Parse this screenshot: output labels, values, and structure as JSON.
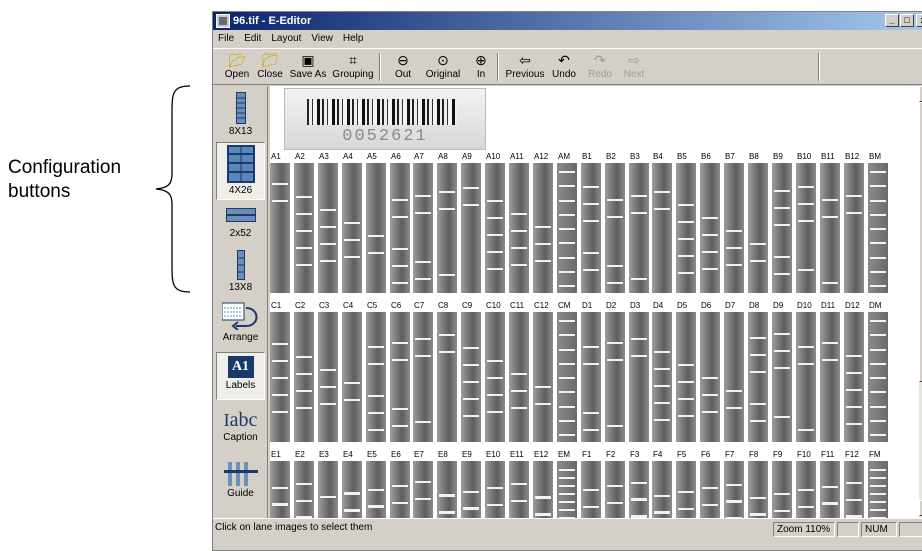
{
  "annotation": {
    "callout_line1": "Configuration",
    "callout_line2": "buttons"
  },
  "window": {
    "title": "96.tif - E-Editor",
    "min_glyph": "_",
    "max_glyph": "□",
    "close_glyph": "x"
  },
  "menu": [
    "File",
    "Edit",
    "Layout",
    "View",
    "Help"
  ],
  "toolbar": {
    "open": "Open",
    "close": "Close",
    "save_as": "Save As",
    "grouping": "Grouping",
    "out": "Out",
    "original": "Original",
    "in": "In",
    "previous": "Previous",
    "undo": "Undo",
    "redo": "Redo",
    "next": "Next"
  },
  "sidebar": {
    "cfg_8x13": "8X13",
    "cfg_4x26": "4X26",
    "cfg_2x52": "2x52",
    "cfg_13x8": "13X8",
    "arrange": "Arrange",
    "labels_badge": "A1",
    "labels": "Labels",
    "caption_glyph": "abc",
    "caption": "Caption",
    "guide": "Guide"
  },
  "barcode": {
    "number": "0052621"
  },
  "rows": [
    [
      "A1",
      "A2",
      "A3",
      "A4",
      "A5",
      "A6",
      "A7",
      "A8",
      "A9",
      "A10",
      "A11",
      "A12",
      "AM",
      "B1",
      "B2",
      "B3",
      "B4",
      "B5",
      "B6",
      "B7",
      "B8",
      "B9",
      "B10",
      "B11",
      "B12",
      "BM"
    ],
    [
      "C1",
      "C2",
      "C3",
      "C4",
      "C5",
      "C6",
      "C7",
      "C8",
      "C9",
      "C10",
      "C11",
      "C12",
      "CM",
      "D1",
      "D2",
      "D3",
      "D4",
      "D5",
      "D6",
      "D7",
      "D8",
      "D9",
      "D10",
      "D11",
      "D12",
      "DM"
    ],
    [
      "E1",
      "E2",
      "E3",
      "E4",
      "E5",
      "E6",
      "E7",
      "E8",
      "E9",
      "E10",
      "E11",
      "E12",
      "EM",
      "F1",
      "F2",
      "F3",
      "F4",
      "F5",
      "F6",
      "F7",
      "F8",
      "F9",
      "F10",
      "F11",
      "F12",
      "FM"
    ]
  ],
  "status": {
    "message": "Click on lane images to select them",
    "zoom": "Zoom 110%",
    "num": "NUM"
  }
}
